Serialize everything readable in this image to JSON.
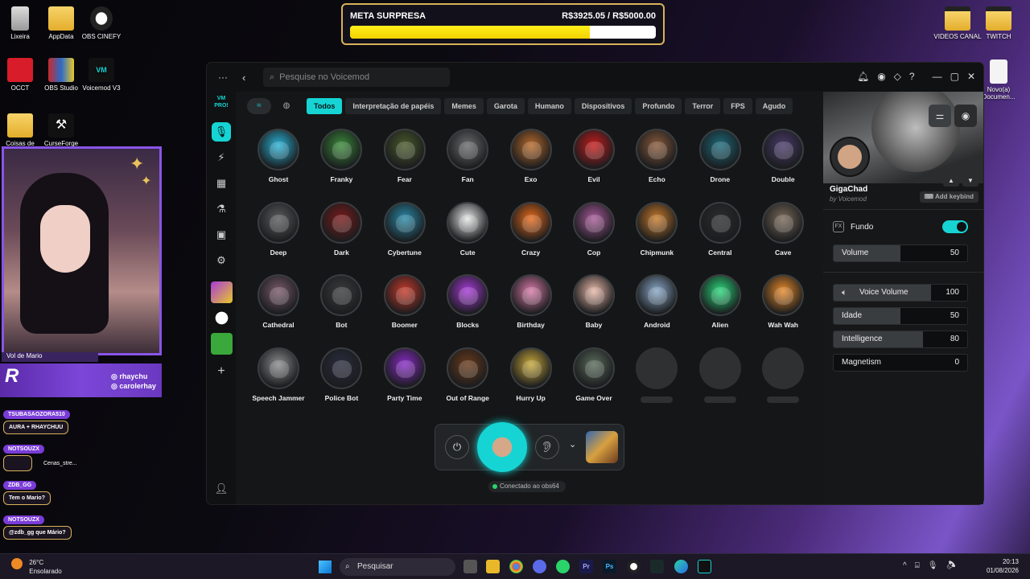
{
  "desktop": {
    "icons_left": [
      {
        "label": "Lixeira"
      },
      {
        "label": "AppData"
      },
      {
        "label": "OBS CINEFY"
      },
      {
        "label": "OCCT"
      },
      {
        "label": "OBS Studio"
      },
      {
        "label": "Voicemod V3"
      },
      {
        "label": "Coisas de"
      },
      {
        "label": "CurseForge"
      }
    ],
    "icons_right": [
      {
        "label": "VIDEOS CANAL"
      },
      {
        "label": "TWITCH"
      },
      {
        "label": "Novo(a) Documen..."
      }
    ]
  },
  "goal": {
    "title": "META SURPRESA",
    "amount": "R$3925.05 / R$5000.00",
    "progress": 0.785
  },
  "stream_overlay": {
    "name_tag": "Vol de Mario",
    "logo": "R",
    "handles": [
      "rhaychu",
      "carolerhay"
    ],
    "chat": [
      {
        "user": "TSUBASAOZORA510",
        "text": "AURA + RHAYCHUU"
      },
      {
        "user": "NOTSOUZX",
        "text": ""
      },
      {
        "user": "ZDB_GG",
        "text": "Tem o Mario?"
      },
      {
        "user": "NOTSOUZX",
        "text": "@zdb_gg que Mário?"
      }
    ],
    "desktop_label": "Cenas_stre..."
  },
  "voicemod": {
    "search_placeholder": "Pesquise no Voicemod",
    "sidebar_logo": "VM PRO!",
    "categories": [
      {
        "label": "Todos",
        "active": true
      },
      {
        "label": "Interpretação de papéis",
        "active": false
      },
      {
        "label": "Memes",
        "active": false
      },
      {
        "label": "Garota",
        "active": false
      },
      {
        "label": "Humano",
        "active": false
      },
      {
        "label": "Dispositivos",
        "active": false
      },
      {
        "label": "Profundo",
        "active": false
      },
      {
        "label": "Terror",
        "active": false
      },
      {
        "label": "FPS",
        "active": false
      },
      {
        "label": "Agudo",
        "active": false
      }
    ],
    "voices": [
      {
        "name": "Ghost",
        "color": "#2ab4d8"
      },
      {
        "name": "Franky",
        "color": "#3a8a3a"
      },
      {
        "name": "Fear",
        "color": "#4a5a2a"
      },
      {
        "name": "Fan",
        "color": "#6a6c6e"
      },
      {
        "name": "Exo",
        "color": "#b86a2a"
      },
      {
        "name": "Evil",
        "color": "#c81c1c"
      },
      {
        "name": "Echo",
        "color": "#8a5a3a"
      },
      {
        "name": "Drone",
        "color": "#1c6a7a"
      },
      {
        "name": "Double",
        "color": "#4a3a6a"
      },
      {
        "name": "Deep",
        "color": "#5a5c5e"
      },
      {
        "name": "Dark",
        "color": "#7a1a1a"
      },
      {
        "name": "Cybertune",
        "color": "#2a8aa8"
      },
      {
        "name": "Cute",
        "color": "#e8e8e8"
      },
      {
        "name": "Crazy",
        "color": "#e86a1a"
      },
      {
        "name": "Cop",
        "color": "#a85a9a"
      },
      {
        "name": "Chipmunk",
        "color": "#c87a2a"
      },
      {
        "name": "Central",
        "color": "#2a2c2e"
      },
      {
        "name": "Cave",
        "color": "#7a6a5a"
      },
      {
        "name": "Cathedral",
        "color": "#7a5a6a"
      },
      {
        "name": "Bot",
        "color": "#3a3c3e"
      },
      {
        "name": "Boomer",
        "color": "#c83a2a"
      },
      {
        "name": "Blocks",
        "color": "#a83ad8"
      },
      {
        "name": "Birthday",
        "color": "#d87aa8"
      },
      {
        "name": "Baby",
        "color": "#e8b8a8"
      },
      {
        "name": "Android",
        "color": "#8aa8c8"
      },
      {
        "name": "Alien",
        "color": "#2ad87a"
      },
      {
        "name": "Wah Wah",
        "color": "#e88a2a"
      },
      {
        "name": "Speech Jammer",
        "color": "#8a8c8e"
      },
      {
        "name": "Police Bot",
        "color": "#2a2c3e"
      },
      {
        "name": "Party Time",
        "color": "#8a2ac8"
      },
      {
        "name": "Out of Range",
        "color": "#6a3a1a"
      },
      {
        "name": "Hurry Up",
        "color": "#c8a83a"
      },
      {
        "name": "Game Over",
        "color": "#5a6a5a"
      }
    ],
    "player": {
      "power_icon": "power-icon",
      "ear_icon": "hear-myself-icon"
    },
    "status": "Conectado ao obs64",
    "selected_voice": {
      "name": "GigaChad",
      "author": "by Voicemod",
      "keybind_label": "Add keybind"
    },
    "fundo": {
      "label": "Fundo",
      "enabled": true
    },
    "params": [
      {
        "label": "Volume",
        "value": "50",
        "fraction": 0.5
      },
      {
        "label": "Voice Volume",
        "value": "100",
        "fraction": 0.73
      },
      {
        "label": "Idade",
        "value": "50",
        "fraction": 0.5
      },
      {
        "label": "Intelligence",
        "value": "80",
        "fraction": 0.67
      },
      {
        "label": "Magnetism",
        "value": "0",
        "fraction": 0
      }
    ]
  },
  "taskbar": {
    "temperature": "26°C",
    "weather": "Ensolarado",
    "search_label": "Pesquisar",
    "time": "20:13",
    "date": "01/08/2026"
  }
}
